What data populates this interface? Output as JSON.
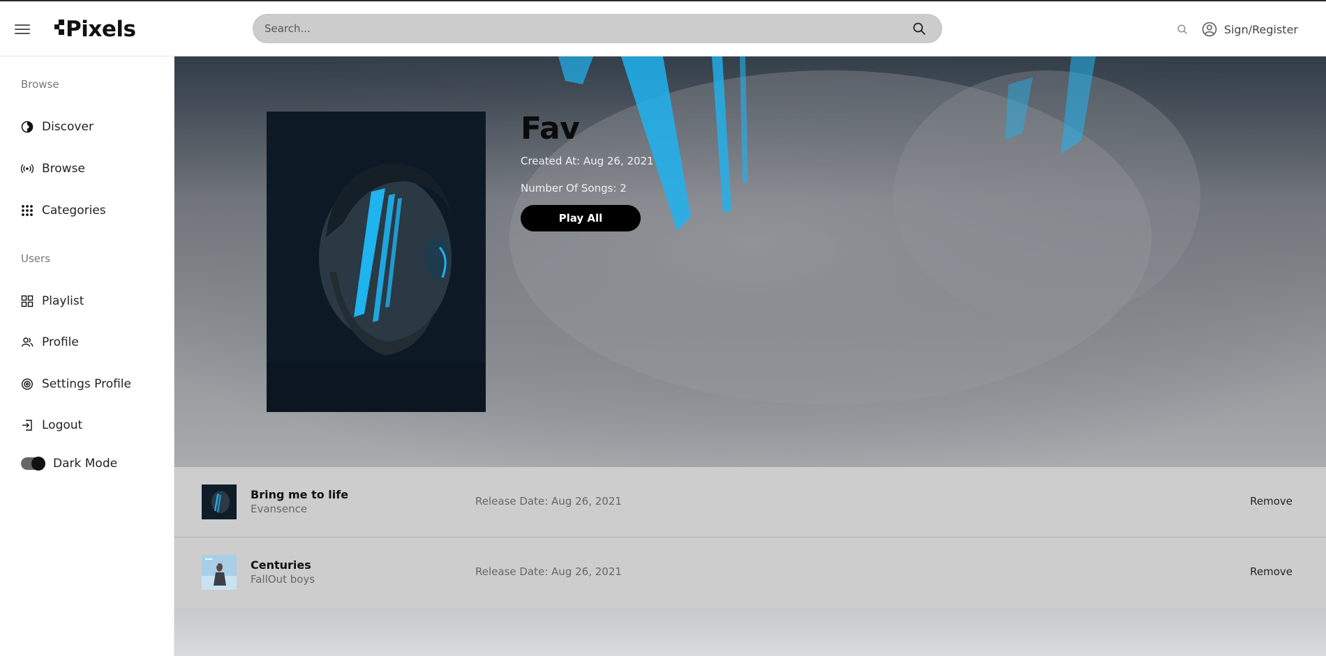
{
  "header": {
    "logo_text": "Pixels",
    "search_placeholder": "Search...",
    "signin_label": "Sign/Register"
  },
  "sidebar": {
    "sections": [
      {
        "label": "Browse"
      },
      {
        "label": "Users"
      }
    ],
    "items": [
      {
        "label": "Discover",
        "icon": "compass-icon"
      },
      {
        "label": "Browse",
        "icon": "broadcast-icon"
      },
      {
        "label": "Categories",
        "icon": "grid-dots-icon"
      },
      {
        "label": "Playlist",
        "icon": "grid-squares-icon"
      },
      {
        "label": "Profile",
        "icon": "users-icon"
      },
      {
        "label": "Settings Profile",
        "icon": "settings-icon"
      },
      {
        "label": "Logout",
        "icon": "logout-icon"
      }
    ],
    "dark_mode_label": "Dark Mode",
    "dark_mode_on": true
  },
  "playlist": {
    "title": "Fav",
    "created_at": "Created At: Aug 26, 2021",
    "num_songs": "Number Of Songs: 2",
    "play_all_label": "Play All"
  },
  "songs": [
    {
      "title": "Bring me to life",
      "artist": "Evansence",
      "release": "Release Date: Aug 26, 2021",
      "remove_label": "Remove"
    },
    {
      "title": "Centuries",
      "artist": "FallOut boys",
      "release": "Release Date: Aug 26, 2021",
      "remove_label": "Remove"
    }
  ],
  "colors": {
    "accent_blue": "#1fb3f0",
    "row_bg": "#cdcdcd",
    "button_bg": "#000000"
  }
}
